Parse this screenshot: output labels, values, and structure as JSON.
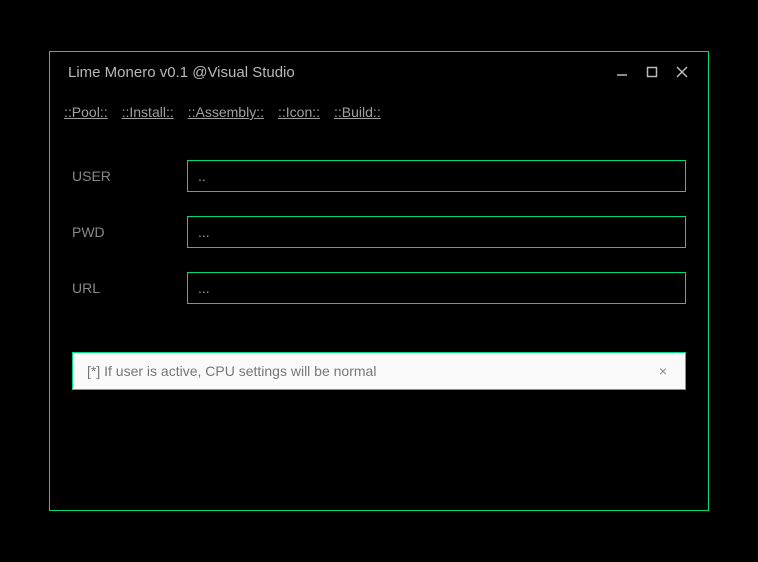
{
  "window": {
    "title": "Lime Monero v0.1 @Visual Studio"
  },
  "tabs": {
    "pool": "::Pool::",
    "install": "::Install::",
    "assembly": "::Assembly::",
    "icon": "::Icon::",
    "build": "::Build::"
  },
  "form": {
    "user": {
      "label": "USER",
      "value": ".."
    },
    "pwd": {
      "label": "PWD",
      "value": "..."
    },
    "url": {
      "label": "URL",
      "value": "..."
    }
  },
  "notice": {
    "text": "[*] If user is active, CPU settings will be normal",
    "close": "×"
  }
}
